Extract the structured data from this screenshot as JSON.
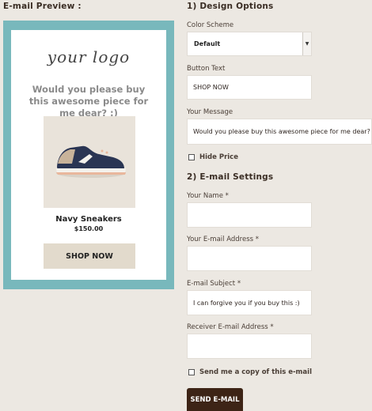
{
  "preview": {
    "title": "E-mail Preview :",
    "logo_text": "your logo",
    "message": "Would you please buy this awesome piece for me dear? :)",
    "product_name": "Navy Sneakers",
    "price": "$150.00",
    "button": "SHOP NOW",
    "colors": {
      "frame": "#78b8bc",
      "button_bg": "#e2dacc"
    }
  },
  "design": {
    "title": "1) Design Options",
    "color_scheme_label": "Color Scheme",
    "color_scheme_value": "Default",
    "button_text_label": "Button Text",
    "button_text_value": "SHOP NOW",
    "message_label": "Your Message",
    "message_value": "Would you please buy this awesome piece for me dear? :)",
    "hide_price_label": "Hide Price"
  },
  "email": {
    "title": "2) E-mail Settings",
    "name_label": "Your Name *",
    "name_value": "",
    "address_label": "Your E-mail Address *",
    "address_value": "",
    "subject_label": "E-mail Subject *",
    "subject_value": "I can forgive you if you buy this :)",
    "receiver_label": "Receiver E-mail Address *",
    "receiver_value": "",
    "copy_label": "Send me a copy of this e-mail",
    "send_button": "SEND E-MAIL",
    "send_color": "#3d2416"
  }
}
